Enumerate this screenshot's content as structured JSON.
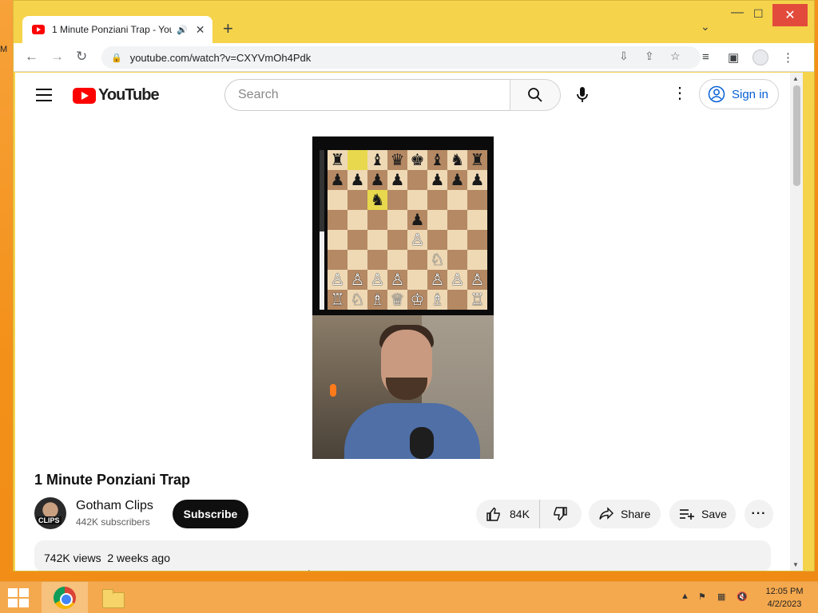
{
  "desktop": {
    "edge_text": "M"
  },
  "browser": {
    "tab_title": "1 Minute Ponziani Trap - You",
    "url": "youtube.com/watch?v=CXYVmOh4Pdk",
    "new_tab_label": "+",
    "icons": {
      "favicon": "youtube-favicon",
      "audio": "speaker-icon",
      "close_tab": "close-icon",
      "back": "back-arrow-icon",
      "forward": "forward-arrow-icon",
      "reload": "reload-icon",
      "lock": "lock-icon",
      "install": "install-icon",
      "share": "share-icon",
      "bookmark": "star-icon",
      "reading_list": "reading-list-icon",
      "side_panel": "side-panel-icon",
      "profile": "profile-icon",
      "menu": "kebab-menu-icon"
    }
  },
  "youtube": {
    "logo_text": "YouTube",
    "search_placeholder": "Search",
    "sign_in_label": "Sign in",
    "video": {
      "title": "1 Minute Ponziani Trap",
      "channel_name": "Gotham Clips",
      "subscribers": "442K subscribers",
      "avatar_badge": "CLIPS",
      "subscribe_label": "Subscribe",
      "likes": "84K",
      "share_label": "Share",
      "save_label": "Save",
      "more_label": "···",
      "views": "742K views",
      "posted": "2 weeks ago"
    },
    "board": {
      "rows": [
        [
          "♜",
          "",
          "♝",
          "♛",
          "♚",
          "♝",
          "♞",
          "♜"
        ],
        [
          "♟",
          "♟",
          "♟",
          "♟",
          "",
          "♟",
          "♟",
          "♟"
        ],
        [
          "",
          "",
          "♞",
          "",
          "",
          "",
          "",
          ""
        ],
        [
          "",
          "",
          "",
          "",
          "♟",
          "",
          "",
          ""
        ],
        [
          "",
          "",
          "",
          "",
          "♙",
          "",
          "",
          ""
        ],
        [
          "",
          "",
          "",
          "",
          "",
          "♘",
          "",
          ""
        ],
        [
          "♙",
          "♙",
          "♙",
          "♙",
          "",
          "♙",
          "♙",
          "♙"
        ],
        [
          "♖",
          "♘",
          "♗",
          "♕",
          "♔",
          "♗",
          "",
          "♖"
        ]
      ],
      "highlights": [
        "0-1",
        "2-2"
      ],
      "eval_white_fraction": 0.49
    }
  },
  "taskbar": {
    "clock_time": "12:05 PM",
    "clock_date": "4/2/2023",
    "tray_icons": [
      "chevron-up-icon",
      "flag-icon",
      "network-icon",
      "volume-muted-icon"
    ]
  }
}
